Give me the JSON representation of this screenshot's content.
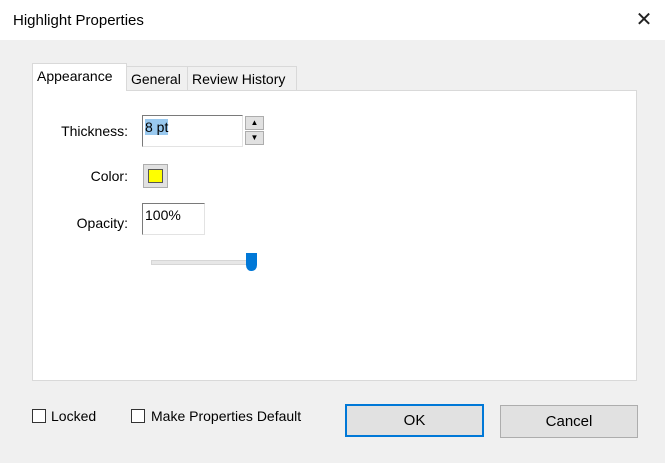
{
  "window": {
    "title": "Highlight Properties",
    "close_icon": "close-icon"
  },
  "tabs": [
    {
      "label": "Appearance",
      "selected": true
    },
    {
      "label": "General",
      "selected": false
    },
    {
      "label": "Review History",
      "selected": false
    }
  ],
  "appearance": {
    "thickness_label": "Thickness:",
    "thickness_value": "8 pt",
    "color_label": "Color:",
    "color_value": "#ffff00",
    "opacity_label": "Opacity:",
    "opacity_value": "100%",
    "opacity_slider_percent": 100
  },
  "footer": {
    "locked_label": "Locked",
    "locked_checked": false,
    "default_label": "Make Properties Default",
    "default_checked": false,
    "ok_label": "OK",
    "cancel_label": "Cancel"
  }
}
